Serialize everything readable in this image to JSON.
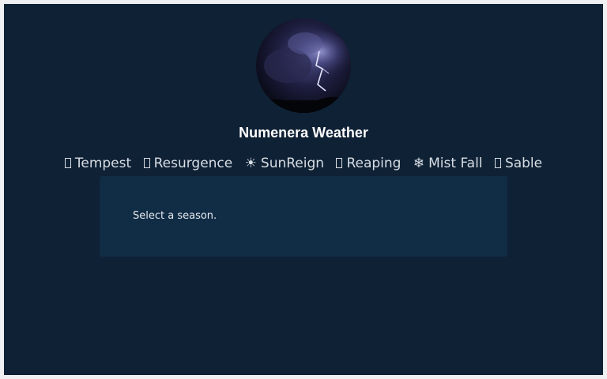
{
  "app": {
    "title": "Numenera Weather"
  },
  "seasons": [
    {
      "label": "Tempest",
      "icon": "storm-icon",
      "glyph": ""
    },
    {
      "label": "Resurgence",
      "icon": "sprout-icon",
      "glyph": ""
    },
    {
      "label": "SunReign",
      "icon": "sun-icon",
      "glyph": "☀"
    },
    {
      "label": "Reaping",
      "icon": "harvest-icon",
      "glyph": ""
    },
    {
      "label": "Mist Fall",
      "icon": "snowflake-icon",
      "glyph": "❄"
    },
    {
      "label": "Sable",
      "icon": "moon-icon",
      "glyph": ""
    }
  ],
  "panel": {
    "message": "Select a season."
  },
  "colors": {
    "background": "#0f2135",
    "panel": "#112c45",
    "text": "#d7dde4"
  }
}
